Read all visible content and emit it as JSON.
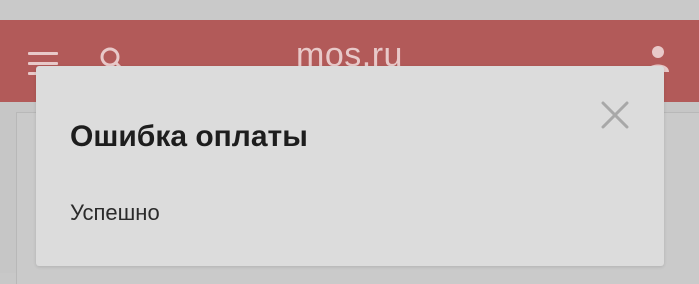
{
  "header": {
    "logo_text": "mos.ru",
    "menu_icon": "menu-icon",
    "search_icon": "search-icon",
    "user_icon": "user-icon",
    "brand_color": "#b25a59"
  },
  "dialog": {
    "title": "Ошибка оплаты",
    "message": "Успешно",
    "close_icon": "close-icon"
  }
}
